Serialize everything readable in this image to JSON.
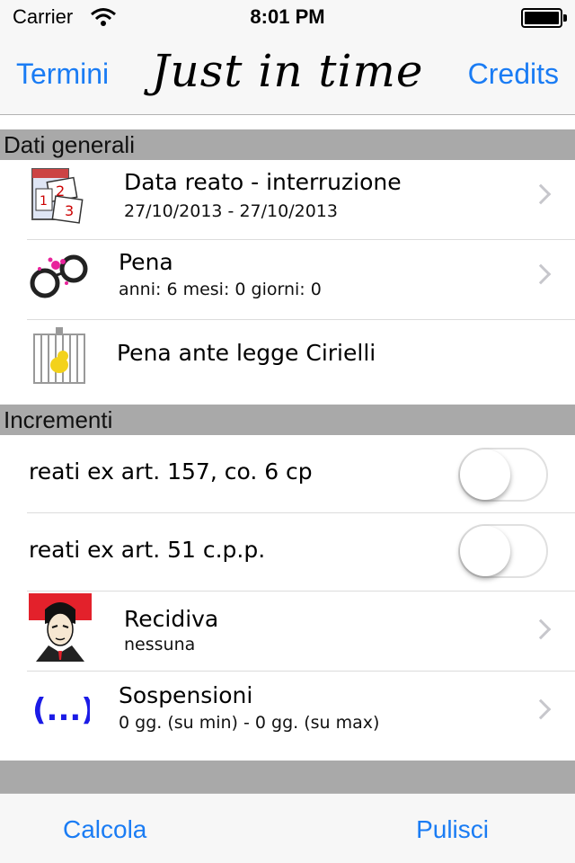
{
  "status_bar": {
    "carrier": "Carrier",
    "time": "8:01 PM"
  },
  "nav": {
    "left": "Termini",
    "title": "Just in time",
    "right": "Credits"
  },
  "sections": {
    "general": "Dati generali",
    "increments": "Incrementi"
  },
  "general_rows": [
    {
      "title": "Data reato - interruzione",
      "subtitle": "27/10/2013  -  27/10/2013",
      "icon": "calendar-icon"
    },
    {
      "title": "Pena",
      "subtitle": "anni: 6 mesi: 0 giorni: 0",
      "icon": "handcuffs-icon"
    },
    {
      "title": "Pena ante legge Cirielli",
      "icon": "birdcage-icon"
    }
  ],
  "increment_rows": [
    {
      "title": "reati ex art. 157, co. 6 cp",
      "toggle_on": false
    },
    {
      "title": "reati ex art. 51 c.p.p.",
      "toggle_on": false
    },
    {
      "title": "Recidiva",
      "subtitle": "nessuna",
      "icon": "avatar-icon"
    },
    {
      "title": "Sospensioni",
      "subtitle": "0  gg. (su min) -  0  gg. (su max)",
      "icon": "ellipsis-icon"
    }
  ],
  "toolbar": {
    "left": "Calcola",
    "right": "Pulisci"
  },
  "colors": {
    "accent": "#1a7cf4",
    "section_bg": "#a9a9a9"
  }
}
